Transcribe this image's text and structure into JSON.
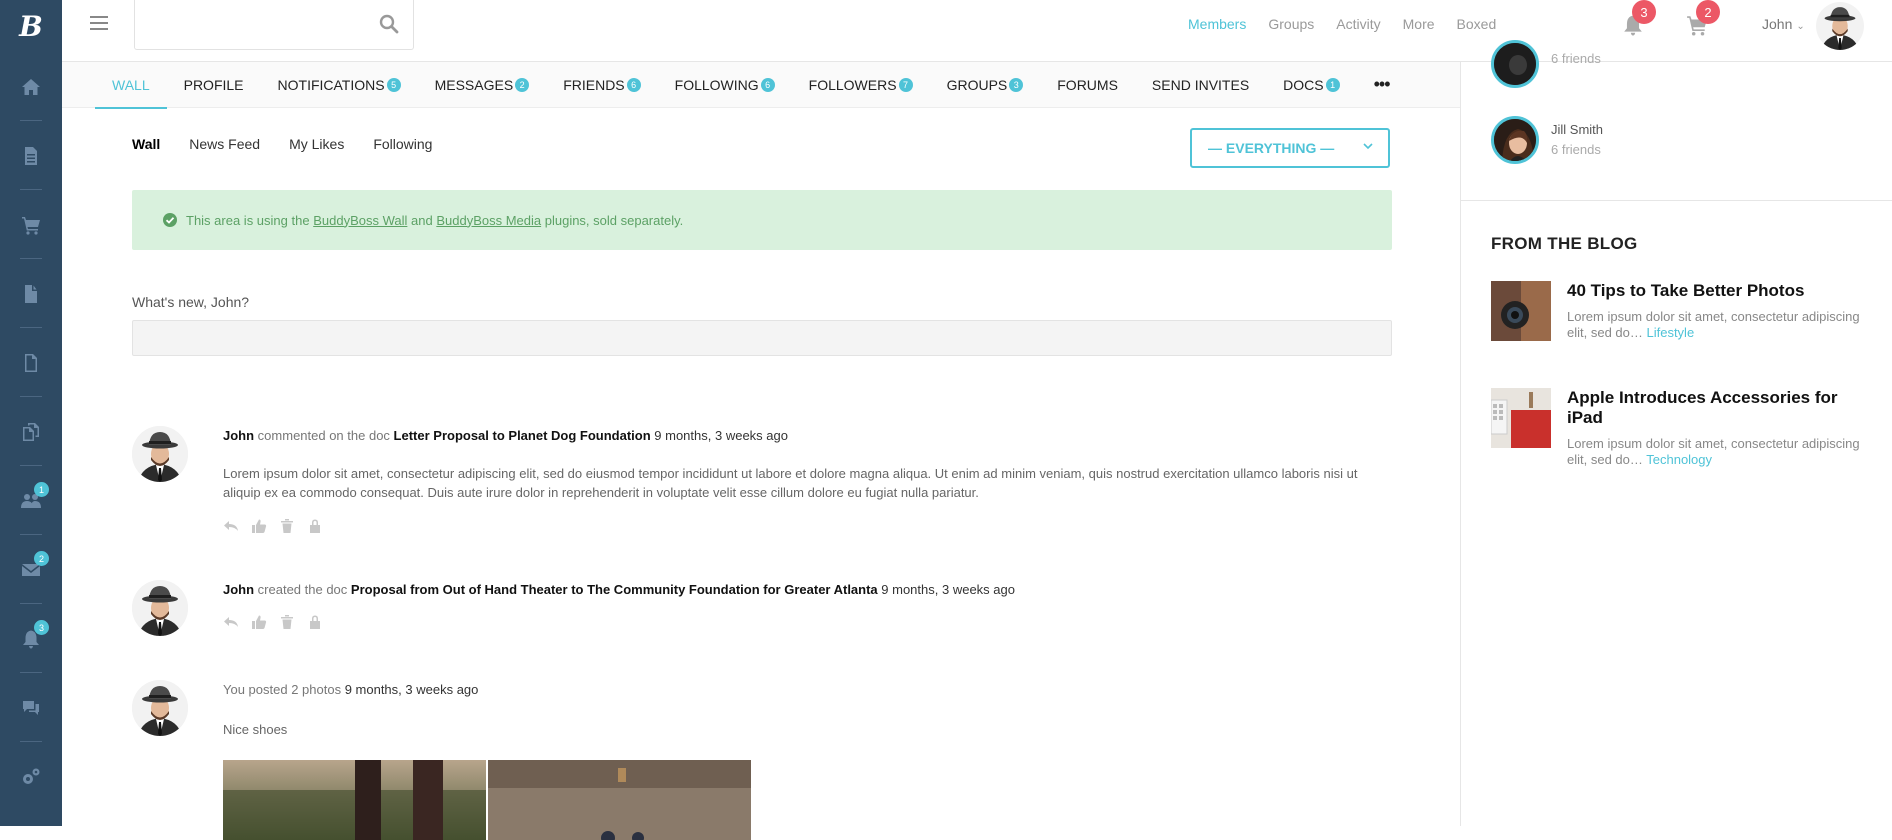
{
  "sidebar": {
    "logo": "B",
    "items": [
      {
        "icon": "home-icon"
      },
      {
        "icon": "document-icon"
      },
      {
        "icon": "cart-icon"
      },
      {
        "icon": "file-icon"
      },
      {
        "icon": "page-icon"
      },
      {
        "icon": "copy-icon"
      },
      {
        "icon": "groups-icon",
        "badge": "1"
      },
      {
        "icon": "mail-icon",
        "badge": "2"
      },
      {
        "icon": "bell-icon",
        "badge": "3"
      },
      {
        "icon": "chat-icon"
      },
      {
        "icon": "settings-icon"
      }
    ]
  },
  "topbar": {
    "search_placeholder": "",
    "nav": [
      "Members",
      "Groups",
      "Activity",
      "More",
      "Boxed"
    ],
    "active_nav": "Members",
    "notifications_count": "3",
    "cart_count": "2",
    "user_name": "John"
  },
  "tabs": [
    {
      "label": "WALL",
      "active": true
    },
    {
      "label": "PROFILE"
    },
    {
      "label": "NOTIFICATIONS",
      "count": "5"
    },
    {
      "label": "MESSAGES",
      "count": "2"
    },
    {
      "label": "FRIENDS",
      "count": "6"
    },
    {
      "label": "FOLLOWING",
      "count": "6"
    },
    {
      "label": "FOLLOWERS",
      "count": "7"
    },
    {
      "label": "GROUPS",
      "count": "3"
    },
    {
      "label": "FORUMS"
    },
    {
      "label": "SEND INVITES"
    },
    {
      "label": "DOCS",
      "count": "1"
    }
  ],
  "more_tabs_label": "•••",
  "subtabs": [
    "Wall",
    "News Feed",
    "My Likes",
    "Following"
  ],
  "filter": {
    "label": "— EVERYTHING —"
  },
  "notice": {
    "prefix": "This area is using the ",
    "link1": "BuddyBoss Wall",
    "middle": " and ",
    "link2": "BuddyBoss Media",
    "suffix": " plugins, sold separately."
  },
  "whats_new": {
    "label": "What's new, John?",
    "value": ""
  },
  "activities": [
    {
      "user": "John",
      "action": " commented on the doc ",
      "target": "Letter Proposal to Planet Dog Foundation",
      "time": " 9 months, 3 weeks ago",
      "text": "Lorem ipsum dolor sit amet, consectetur adipiscing elit, sed do eiusmod tempor incididunt ut labore et dolore magna aliqua. Ut enim ad minim veniam, quis nostrud exercitation ullamco laboris nisi ut aliquip ex ea commodo consequat. Duis aute irure dolor in reprehenderit in voluptate velit esse cillum dolore eu fugiat nulla pariatur."
    },
    {
      "user": "John",
      "action": " created the doc ",
      "target": "Proposal from Out of Hand Theater to The Community Foundation for Greater Atlanta",
      "time": " 9 months, 3 weeks ago"
    },
    {
      "action": "You posted 2 photos",
      "time": " 9 months, 3 weeks ago",
      "text": "Nice shoes"
    }
  ],
  "friends": [
    {
      "name": "",
      "count": "6 friends"
    },
    {
      "name": "Jill Smith",
      "count": "6 friends"
    }
  ],
  "blog": {
    "title": "FROM THE BLOG",
    "posts": [
      {
        "title": "40 Tips to Take Better Photos",
        "excerpt": "Lorem ipsum dolor sit amet, consectetur adipiscing elit, sed do…",
        "category": " Lifestyle"
      },
      {
        "title": "Apple Introduces Accessories for iPad",
        "excerpt": "Lorem ipsum dolor sit amet, consectetur adipiscing elit, sed do…",
        "category": " Technology"
      }
    ]
  },
  "colors": {
    "accent": "#4fc3d7",
    "sidebar": "#2e4a63",
    "badge_red": "#ec5866",
    "notice_bg": "#d9f1dd"
  }
}
